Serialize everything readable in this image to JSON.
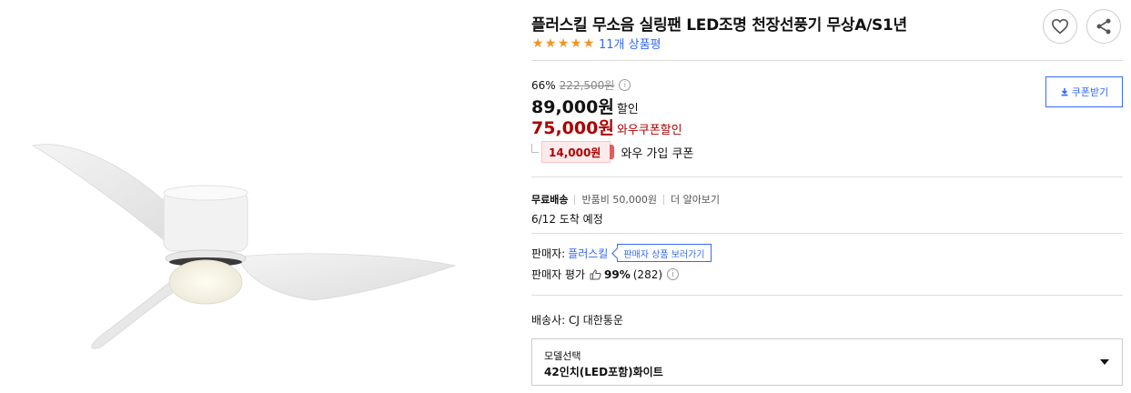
{
  "product": {
    "title": "플러스킬 무소음 실링팬 LED조명 천장선풍기 무상A/S1년",
    "rating_stars": 5,
    "review_count_label": "11개 상품평",
    "image_icon": "ceiling-fan-image"
  },
  "actions": {
    "wishlist_icon": "heart-icon",
    "share_icon": "share-icon"
  },
  "pricing": {
    "discount_rate": "66%",
    "original_price": "222,500원",
    "sale_price": "89,000원",
    "sale_tag": "할인",
    "coupon_price": "75,000원",
    "coupon_tag": "와우쿠폰할인",
    "coupon_button": "쿠폰받기",
    "member_coupon_amount": "14,000원",
    "member_coupon_label": "와우 가입 쿠폰"
  },
  "shipping": {
    "free_label": "무료배송",
    "return_fee": "반품비 50,000원",
    "more_label": "더 알아보기",
    "arrival": "6/12 도착 예정",
    "carrier": "배송사: CJ 대한통운"
  },
  "seller": {
    "label": "판매자:",
    "name": "플러스킬",
    "products_button": "판매자 상품 보러가기",
    "rating_label": "판매자 평가",
    "rating_percent": "99%",
    "rating_count": "(282)"
  },
  "option": {
    "label": "모델선택",
    "selected": "42인치(LED포함)화이트"
  },
  "colors": {
    "accent_blue": "#346aff",
    "price_red": "#ae0000",
    "star_orange": "#f29423"
  }
}
